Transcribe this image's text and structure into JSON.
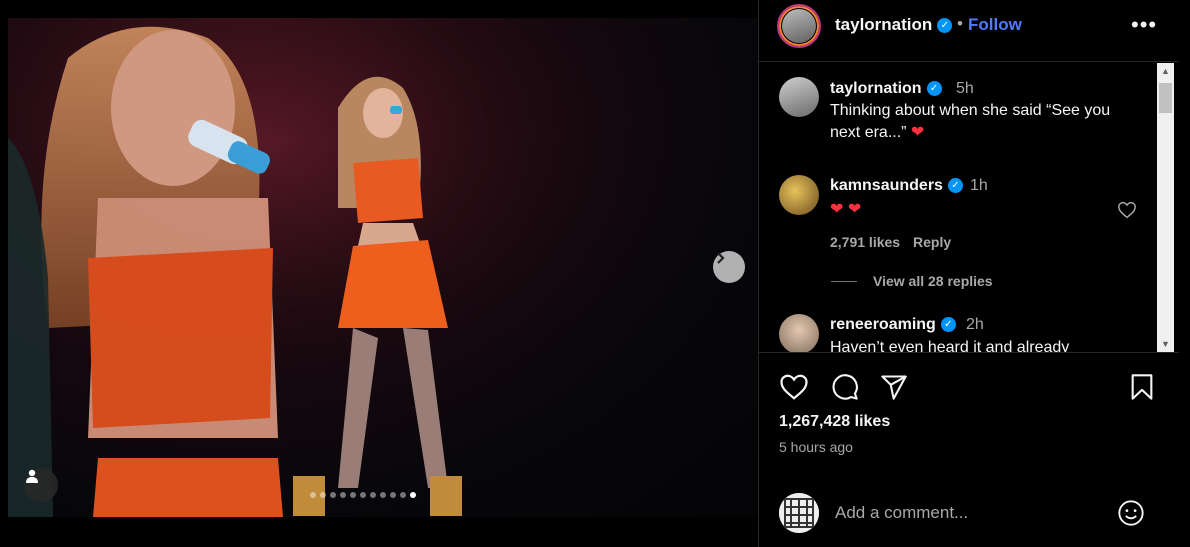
{
  "post": {
    "author": "taylornation",
    "follow_label": "Follow",
    "separator": "•",
    "more_label": "•••",
    "likes": "1,267,428 likes",
    "time_ago": "5 hours ago",
    "carousel": {
      "count": 11,
      "active_index": 10
    }
  },
  "comments": [
    {
      "user": "taylornation",
      "time": "5h",
      "text_line1": "Thinking about when she said “See you",
      "text_line2": "next era...” ",
      "verified": true
    },
    {
      "user": "kamnsaunders",
      "time": "1h",
      "text": "",
      "likes": "2,791 likes",
      "reply_label": "Reply",
      "verified": true
    },
    {
      "view_replies": "View all 28 replies"
    },
    {
      "user": "reneeroaming",
      "time": "2h",
      "text": "Haven’t even heard it and already",
      "verified": true
    }
  ],
  "add_comment": {
    "placeholder": "Add a comment..."
  },
  "icons": {
    "next": "chevron-right-icon",
    "tag": "user-tag-icon",
    "like": "heart-icon",
    "comment": "comment-icon",
    "share": "send-icon",
    "save": "bookmark-icon",
    "emoji": "emoji-icon",
    "more": "more-options-icon"
  },
  "colors": {
    "accent": "#4e7bff",
    "verified": "#0095f6",
    "heart_emoji": "#ff3040"
  }
}
